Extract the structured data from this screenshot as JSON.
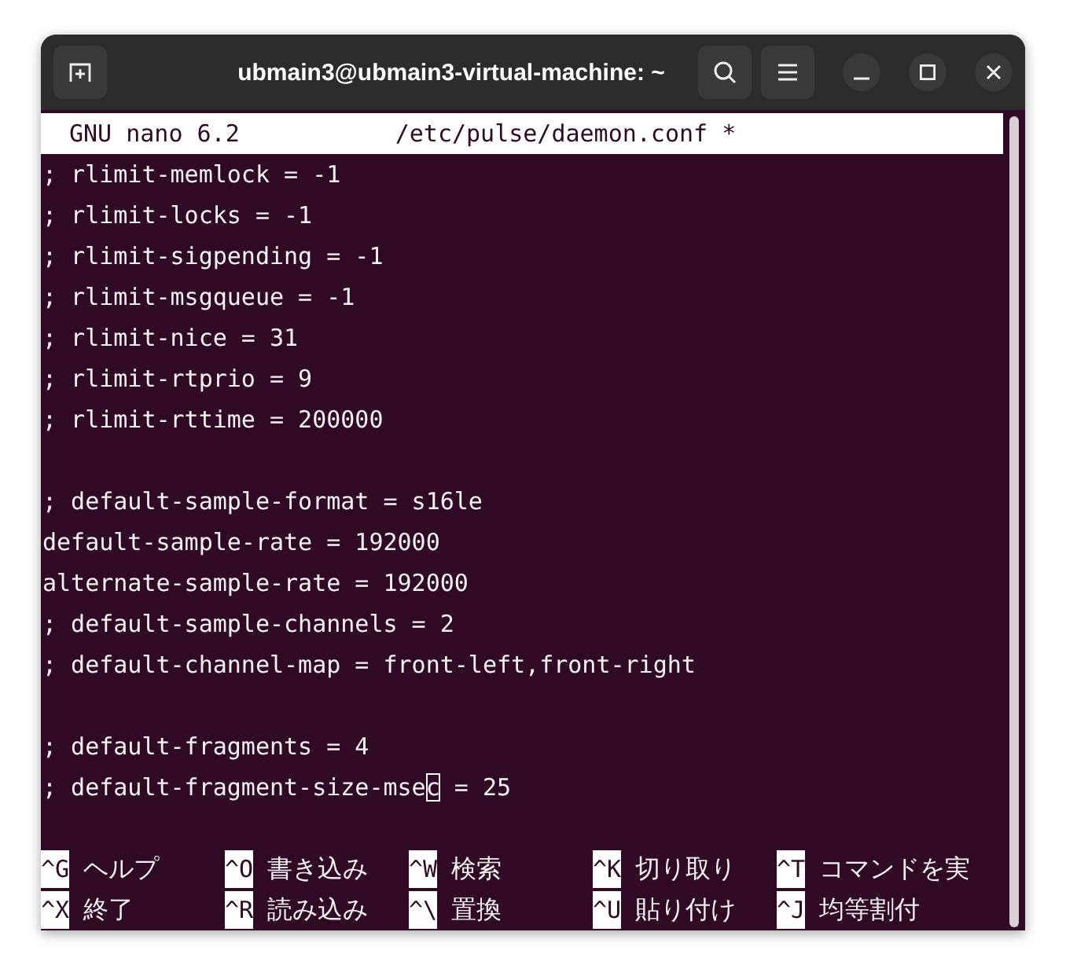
{
  "window": {
    "title": "ubmain3@ubmain3-virtual-machine: ~"
  },
  "header": {
    "app": "GNU nano 6.2",
    "file": "/etc/pulse/daemon.conf *"
  },
  "lines": [
    {
      "kind": "text",
      "text": "; rlimit-memlock = -1"
    },
    {
      "kind": "text",
      "text": "; rlimit-locks = -1"
    },
    {
      "kind": "text",
      "text": "; rlimit-sigpending = -1"
    },
    {
      "kind": "text",
      "text": "; rlimit-msgqueue = -1"
    },
    {
      "kind": "text",
      "text": "; rlimit-nice = 31"
    },
    {
      "kind": "text",
      "text": "; rlimit-rtprio = 9"
    },
    {
      "kind": "text",
      "text": "; rlimit-rttime = 200000"
    },
    {
      "kind": "blank"
    },
    {
      "kind": "text",
      "text": "; default-sample-format = s16le"
    },
    {
      "kind": "text",
      "text": "default-sample-rate = 192000"
    },
    {
      "kind": "text",
      "text": "alternate-sample-rate = 192000"
    },
    {
      "kind": "text",
      "text": "; default-sample-channels = 2"
    },
    {
      "kind": "text",
      "text": "; default-channel-map = front-left,front-right"
    },
    {
      "kind": "blank"
    },
    {
      "kind": "text",
      "text": "; default-fragments = 4"
    },
    {
      "kind": "cursor",
      "before": "; default-fragment-size-mse",
      "cursor": "c",
      "after": " = 25"
    },
    {
      "kind": "blank"
    }
  ],
  "shortcuts": [
    [
      {
        "key": "^G",
        "label": "ヘルプ"
      },
      {
        "key": "^O",
        "label": "書き込み"
      },
      {
        "key": "^W",
        "label": "検索"
      },
      {
        "key": "^K",
        "label": "切り取り"
      },
      {
        "key": "^T",
        "label": "コマンドを実"
      }
    ],
    [
      {
        "key": "^X",
        "label": "終了"
      },
      {
        "key": "^R",
        "label": "読み込み"
      },
      {
        "key": "^\\",
        "label": "置換"
      },
      {
        "key": "^U",
        "label": "貼り付け"
      },
      {
        "key": "^J",
        "label": "均等割付"
      }
    ]
  ]
}
